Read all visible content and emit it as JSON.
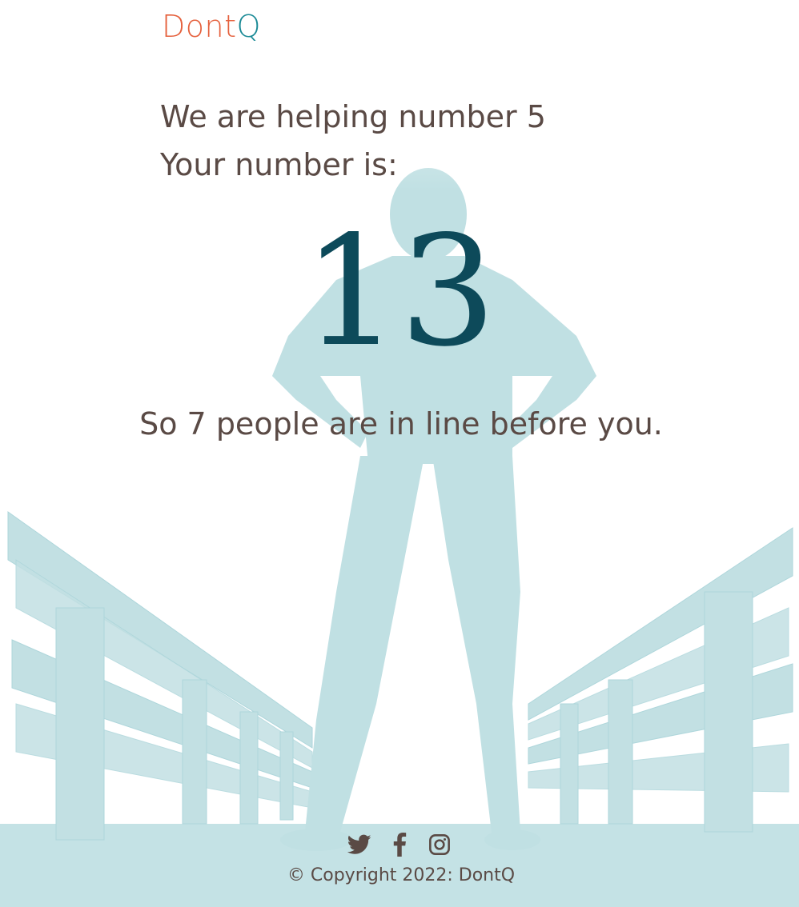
{
  "brand": {
    "logo_part1": "Dont",
    "logo_part2": "Q",
    "colors": {
      "logo_primary": "#e5603c",
      "logo_accent": "#1a8a96",
      "number": "#0d4a5a",
      "text": "#5a4a45",
      "artwork": "#bfe0e3"
    }
  },
  "queue": {
    "helping_text": "We are helping number 5",
    "your_number_label": "Your number is:",
    "your_number": "13",
    "people_ahead_text": "So 7 people are in line before you."
  },
  "footer": {
    "social_icons": [
      "twitter-icon",
      "facebook-icon",
      "instagram-icon"
    ],
    "copyright": "© Copyright 2022: DontQ"
  }
}
